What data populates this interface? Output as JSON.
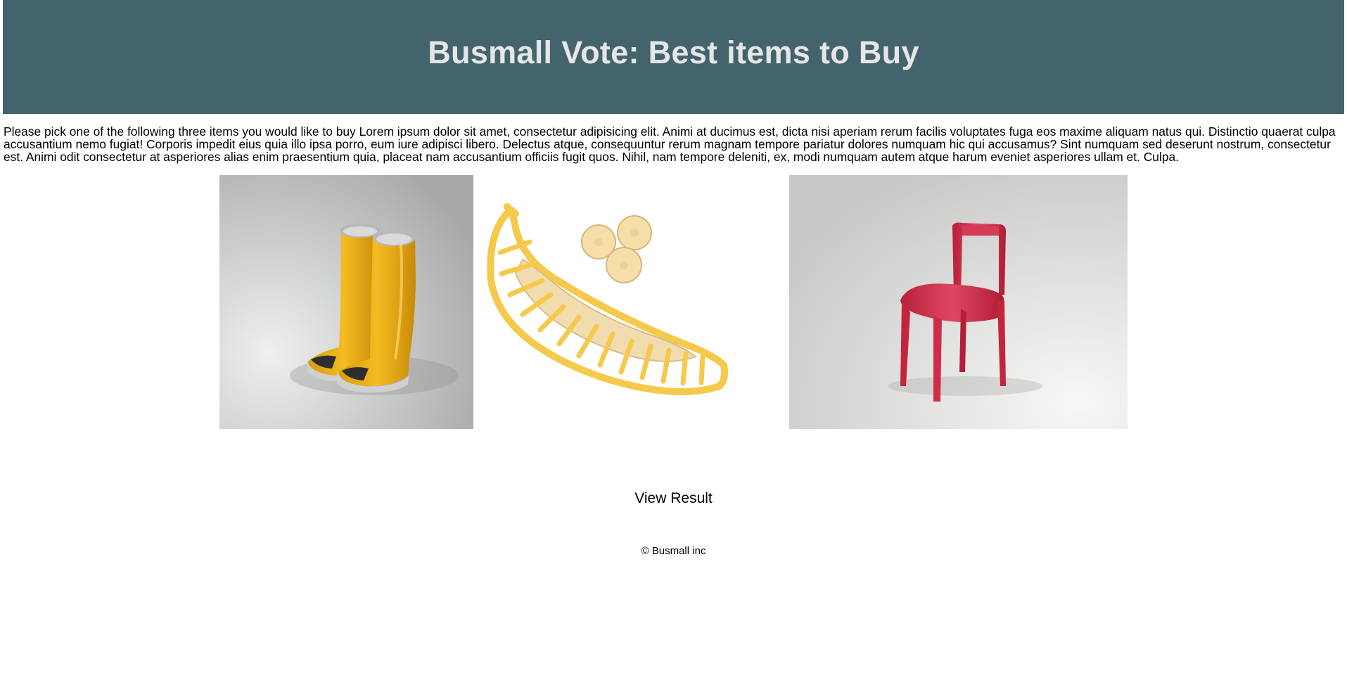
{
  "header": {
    "title": "Busmall Vote: Best items to Buy"
  },
  "intro": {
    "text": "Please pick one of the following three items you would like to buy Lorem ipsum dolor sit amet, consectetur adipisicing elit. Animi at ducimus est, dicta nisi aperiam rerum facilis voluptates fuga eos maxime aliquam natus qui. Distinctio quaerat culpa accusantium nemo fugiat! Corporis impedit eius quia illo ipsa porro, eum iure adipisci libero. Delectus atque, consequuntur rerum magnam tempore pariatur dolores numquam hic qui accusamus? Sint numquam sed deserunt nostrum, consectetur est. Animi odit consectetur at asperiores alias enim praesentium quia, placeat nam accusantium officiis fugit quos. Nihil, nam tempore deleniti, ex, modi numquam autem atque harum eveniet asperiores ullam et. Culpa."
  },
  "items": [
    {
      "icon": "yellow-boots-image"
    },
    {
      "icon": "banana-slicer-image"
    },
    {
      "icon": "red-chair-image"
    }
  ],
  "actions": {
    "view_result_label": "View Result"
  },
  "footer": {
    "text": "© Busmall inc"
  },
  "colors": {
    "header_bg": "#43636d",
    "header_text": "#e6e6e6"
  }
}
